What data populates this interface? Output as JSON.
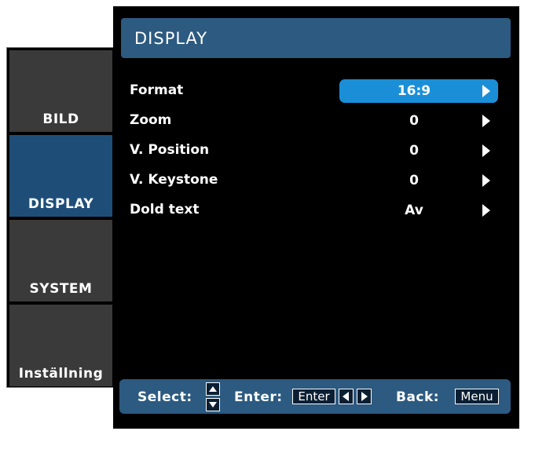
{
  "tabs": [
    {
      "label": "BILD",
      "active": false
    },
    {
      "label": "DISPLAY",
      "active": true
    },
    {
      "label": "SYSTEM",
      "active": false
    },
    {
      "label": "Inställning",
      "active": false
    }
  ],
  "header": {
    "title": "DISPLAY"
  },
  "rows": [
    {
      "label": "Format",
      "value": "16:9",
      "selected": true
    },
    {
      "label": "Zoom",
      "value": "0",
      "selected": false
    },
    {
      "label": "V. Position",
      "value": "0",
      "selected": false
    },
    {
      "label": "V. Keystone",
      "value": "0",
      "selected": false
    },
    {
      "label": "Dold text",
      "value": "Av",
      "selected": false
    }
  ],
  "footer": {
    "select_label": "Select:",
    "enter_label": "Enter:",
    "enter_key": "Enter",
    "back_label": "Back:",
    "menu_key": "Menu"
  },
  "colors": {
    "active_tab": "#1e4e78",
    "header": "#2c5a80",
    "selection": "#1a8fd8"
  },
  "icons": [
    "up-arrow-icon",
    "down-arrow-icon",
    "left-arrow-icon",
    "right-arrow-icon",
    "value-arrow-icon"
  ]
}
